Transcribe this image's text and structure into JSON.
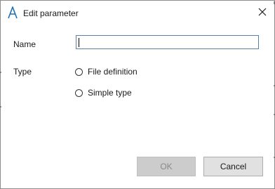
{
  "dialog": {
    "title": "Edit parameter",
    "app_icon": "app-logo-a-icon",
    "close_icon": "close-icon"
  },
  "form": {
    "name_label": "Name",
    "name_value": "",
    "type_label": "Type",
    "type_options": [
      {
        "label": "File definition",
        "selected": false
      },
      {
        "label": "Simple type",
        "selected": false
      }
    ]
  },
  "buttons": {
    "ok_label": "OK",
    "ok_enabled": false,
    "cancel_label": "Cancel"
  },
  "colors": {
    "app_icon": "#1f6fb4",
    "input_border": "#5b7fa6",
    "disabled_button": "#cccccc",
    "button": "#e1e1e1"
  }
}
